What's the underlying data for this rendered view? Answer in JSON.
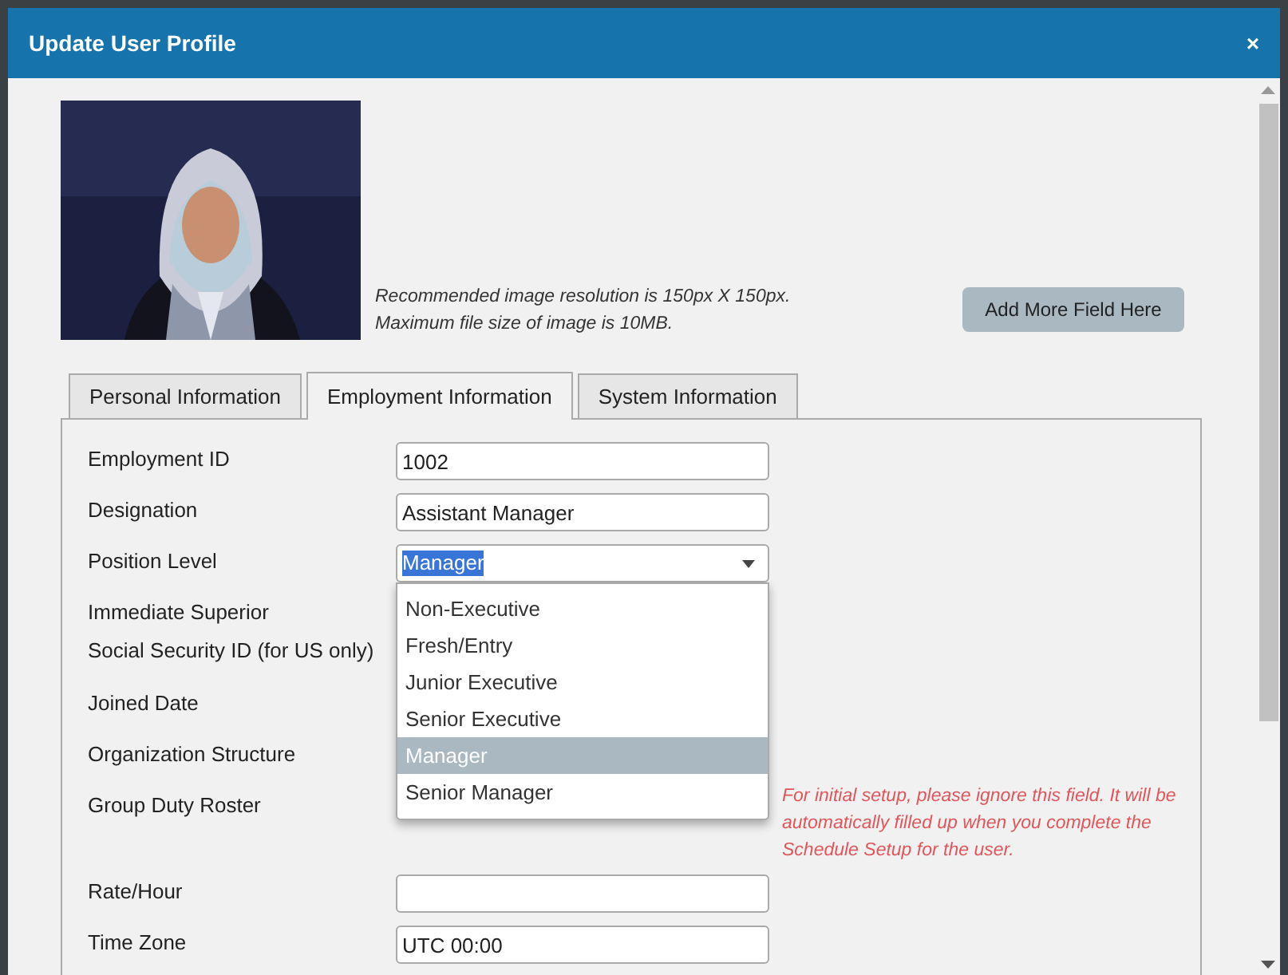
{
  "dialog": {
    "title": "Update User Profile",
    "close": "×"
  },
  "photo": {
    "kind": "picture",
    "note_lines": [
      "Recommended image resolution is 150px X 150px.",
      "Maximum file size of image is 10MB."
    ]
  },
  "add_field_button": "Add More Field Here",
  "tabs": [
    {
      "label": "Personal Information",
      "selected": false
    },
    {
      "label": "Employment Information",
      "selected": true
    },
    {
      "label": "System Information",
      "selected": false
    }
  ],
  "fields": [
    {
      "label": "Employment ID",
      "kind": "text",
      "value": "1002"
    },
    {
      "label": "Designation",
      "kind": "text",
      "value": "Assistant Manager"
    },
    {
      "label": "Position Level",
      "kind": "select",
      "value": "Manager",
      "open": true,
      "options": [
        {
          "label": "Non-Executive",
          "selected": false
        },
        {
          "label": "Fresh/Entry",
          "selected": false
        },
        {
          "label": "Junior Executive",
          "selected": false
        },
        {
          "label": "Senior Executive",
          "selected": false
        },
        {
          "label": "Manager",
          "selected": true
        },
        {
          "label": "Senior Manager",
          "selected": false
        }
      ]
    },
    {
      "label": "Immediate Superior",
      "kind": "covered"
    },
    {
      "label": "Social Security ID (for US only)",
      "kind": "covered"
    },
    {
      "label": "Joined Date",
      "kind": "covered"
    },
    {
      "label": "Organization Structure",
      "kind": "covered"
    },
    {
      "label": "Group Duty Roster",
      "kind": "covered",
      "note": "For initial setup, please ignore this field. It will be automatically filled up when you complete the Schedule Setup for the user."
    },
    {
      "label": "Rate/Hour",
      "kind": "text"
    },
    {
      "label": "Time Zone",
      "kind": "text",
      "value": "UTC 00:00"
    }
  ]
}
